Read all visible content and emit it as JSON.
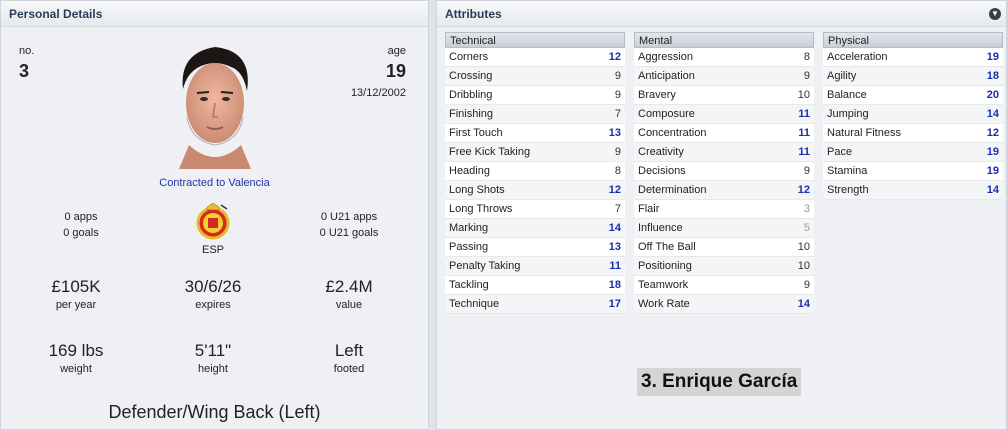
{
  "personal": {
    "title": "Personal Details",
    "no_label": "no.",
    "no_value": "3",
    "age_label": "age",
    "age_value": "19",
    "dob": "13/12/2002",
    "contract": "Contracted to Valencia",
    "apps": "0 apps",
    "goals": "0 goals",
    "u21_apps": "0 U21 apps",
    "u21_goals": "0 U21 goals",
    "nation": "ESP",
    "wage": "£105K",
    "wage_sub": "per year",
    "expires": "30/6/26",
    "expires_sub": "expires",
    "value": "£2.4M",
    "value_sub": "value",
    "weight": "169 lbs",
    "weight_sub": "weight",
    "height": "5'11\"",
    "height_sub": "height",
    "foot": "Left",
    "foot_sub": "footed",
    "position": "Defender/Wing Back (Left)"
  },
  "attributes": {
    "title": "Attributes",
    "player_name": "3. Enrique García",
    "technical": {
      "label": "Technical",
      "items": [
        {
          "name": "Corners",
          "value": "12"
        },
        {
          "name": "Crossing",
          "value": "9"
        },
        {
          "name": "Dribbling",
          "value": "9"
        },
        {
          "name": "Finishing",
          "value": "7"
        },
        {
          "name": "First Touch",
          "value": "13"
        },
        {
          "name": "Free Kick Taking",
          "value": "9"
        },
        {
          "name": "Heading",
          "value": "8"
        },
        {
          "name": "Long Shots",
          "value": "12"
        },
        {
          "name": "Long Throws",
          "value": "7"
        },
        {
          "name": "Marking",
          "value": "14"
        },
        {
          "name": "Passing",
          "value": "13"
        },
        {
          "name": "Penalty Taking",
          "value": "11"
        },
        {
          "name": "Tackling",
          "value": "18"
        },
        {
          "name": "Technique",
          "value": "17"
        }
      ]
    },
    "mental": {
      "label": "Mental",
      "items": [
        {
          "name": "Aggression",
          "value": "8"
        },
        {
          "name": "Anticipation",
          "value": "9"
        },
        {
          "name": "Bravery",
          "value": "10"
        },
        {
          "name": "Composure",
          "value": "11"
        },
        {
          "name": "Concentration",
          "value": "11"
        },
        {
          "name": "Creativity",
          "value": "11"
        },
        {
          "name": "Decisions",
          "value": "9"
        },
        {
          "name": "Determination",
          "value": "12"
        },
        {
          "name": "Flair",
          "value": "3"
        },
        {
          "name": "Influence",
          "value": "5"
        },
        {
          "name": "Off The Ball",
          "value": "10"
        },
        {
          "name": "Positioning",
          "value": "10"
        },
        {
          "name": "Teamwork",
          "value": "9"
        },
        {
          "name": "Work Rate",
          "value": "14"
        }
      ]
    },
    "physical": {
      "label": "Physical",
      "items": [
        {
          "name": "Acceleration",
          "value": "19"
        },
        {
          "name": "Agility",
          "value": "18"
        },
        {
          "name": "Balance",
          "value": "20"
        },
        {
          "name": "Jumping",
          "value": "14"
        },
        {
          "name": "Natural Fitness",
          "value": "12"
        },
        {
          "name": "Pace",
          "value": "19"
        },
        {
          "name": "Stamina",
          "value": "19"
        },
        {
          "name": "Strength",
          "value": "14"
        }
      ]
    }
  },
  "colors": {
    "high": "#1a2fb0",
    "mid": "#333333",
    "low": "#9a9a9a"
  }
}
